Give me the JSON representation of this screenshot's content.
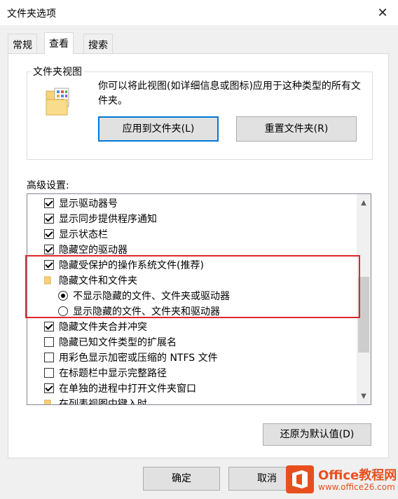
{
  "window": {
    "title": "文件夹选项",
    "close_glyph": "✕"
  },
  "tabs": [
    {
      "label": "常规",
      "active": false
    },
    {
      "label": "查看",
      "active": true
    },
    {
      "label": "搜索",
      "active": false
    }
  ],
  "folder_views": {
    "legend": "文件夹视图",
    "description": "你可以将此视图(如详细信息或图标)应用于这种类型的所有文件夹。",
    "apply_button": "应用到文件夹(L)",
    "reset_button": "重置文件夹(R)"
  },
  "advanced": {
    "label": "高级设置:",
    "items": [
      {
        "kind": "checkbox",
        "checked": true,
        "label": "显示驱动器号"
      },
      {
        "kind": "checkbox",
        "checked": true,
        "label": "显示同步提供程序通知"
      },
      {
        "kind": "checkbox",
        "checked": true,
        "label": "显示状态栏"
      },
      {
        "kind": "checkbox",
        "checked": true,
        "label": "隐藏空的驱动器"
      },
      {
        "kind": "checkbox",
        "checked": true,
        "label": "隐藏受保护的操作系统文件(推荐)"
      },
      {
        "kind": "folder",
        "checked": false,
        "label": "隐藏文件和文件夹"
      },
      {
        "kind": "radio",
        "checked": true,
        "label": "不显示隐藏的文件、文件夹或驱动器"
      },
      {
        "kind": "radio",
        "checked": false,
        "label": "显示隐藏的文件、文件夹和驱动器"
      },
      {
        "kind": "checkbox",
        "checked": true,
        "label": "隐藏文件夹合并冲突"
      },
      {
        "kind": "checkbox",
        "checked": false,
        "label": "隐藏已知文件类型的扩展名"
      },
      {
        "kind": "checkbox",
        "checked": false,
        "label": "用彩色显示加密或压缩的 NTFS 文件"
      },
      {
        "kind": "checkbox",
        "checked": false,
        "label": "在标题栏中显示完整路径"
      },
      {
        "kind": "checkbox",
        "checked": true,
        "label": "在单独的进程中打开文件夹窗口"
      },
      {
        "kind": "folder",
        "checked": false,
        "label": "在列表视图中键入时"
      }
    ],
    "restore_button": "还原为默认值(D)"
  },
  "footer": {
    "ok_button": "确定",
    "cancel_button": "取消"
  },
  "watermark": {
    "main": "Office教程网",
    "url": "www.office26.com"
  },
  "colors": {
    "highlight": "#e0262d",
    "focus": "#0078d7",
    "brand": "#e7501e"
  }
}
